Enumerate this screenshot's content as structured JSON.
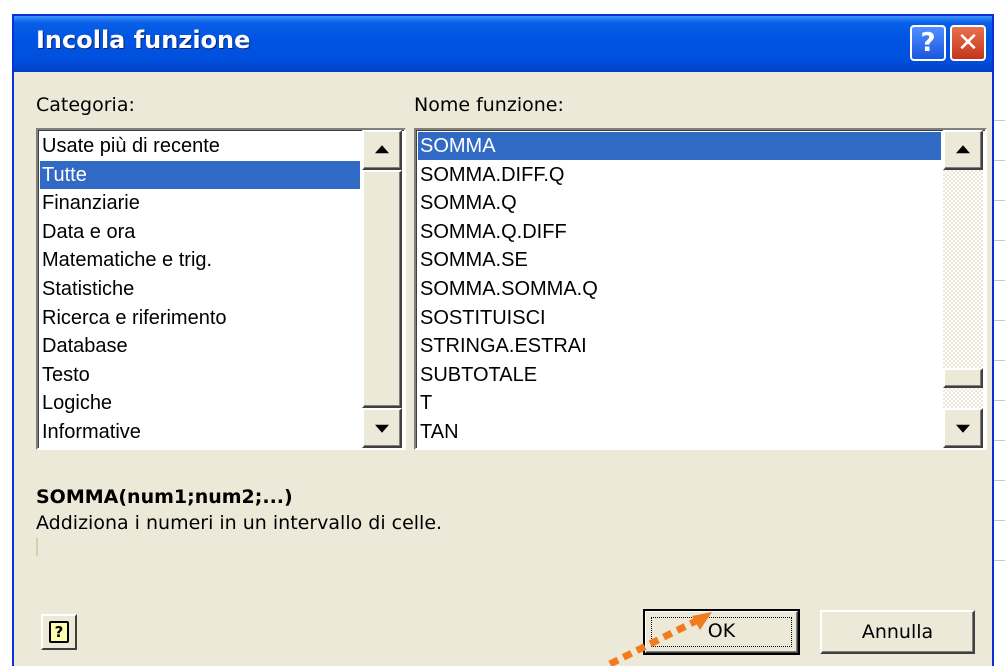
{
  "dialog": {
    "title": "Incolla funzione",
    "help_button_label": "?",
    "close_button_label": "✕"
  },
  "categories": {
    "label": "Categoria:",
    "items": [
      "Usate più di recente",
      "Tutte",
      "Finanziarie",
      "Data e ora",
      "Matematiche e trig.",
      "Statistiche",
      "Ricerca e riferimento",
      "Database",
      "Testo",
      "Logiche",
      "Informative"
    ],
    "selected": "Tutte"
  },
  "functions": {
    "label": "Nome funzione:",
    "items": [
      "SOMMA",
      "SOMMA.DIFF.Q",
      "SOMMA.Q",
      "SOMMA.Q.DIFF",
      "SOMMA.SE",
      "SOMMA.SOMMA.Q",
      "SOSTITUISCI",
      "STRINGA.ESTRAI",
      "SUBTOTALE",
      "T",
      "TAN"
    ],
    "selected": "SOMMA"
  },
  "details": {
    "signature": "SOMMA(num1;num2;...)",
    "description": "Addiziona i numeri in un intervallo di celle."
  },
  "buttons": {
    "ok": "OK",
    "cancel": "Annulla"
  },
  "colors": {
    "titlebar": "#0054e3",
    "selection": "#316ac5",
    "dialog_face": "#ece9d8",
    "annotation_arrow": "#f07c1e"
  },
  "icons": {
    "help": "question-mark-icon",
    "close": "close-icon",
    "scroll_up": "arrow-up-icon",
    "scroll_down": "arrow-down-icon"
  }
}
